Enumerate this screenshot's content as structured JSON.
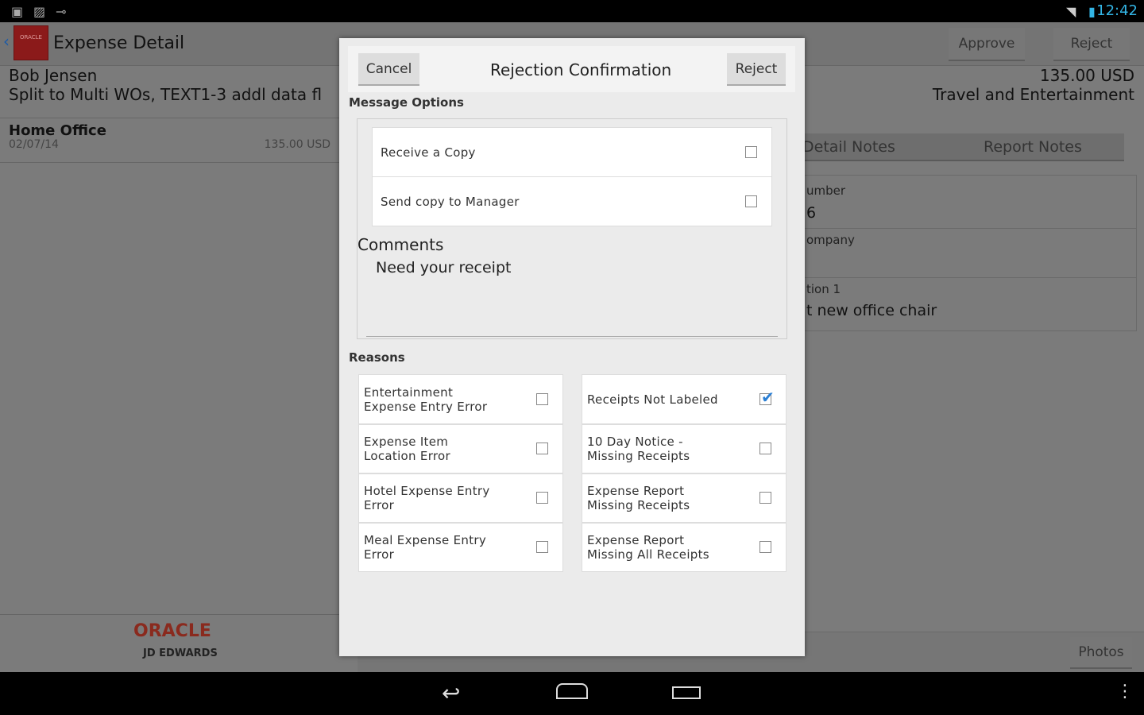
{
  "status_bar": {
    "time": "12:42",
    "icons": [
      "download-icon",
      "image-icon",
      "key-icon",
      "wifi-icon",
      "battery-charging-icon"
    ]
  },
  "header": {
    "title": "Expense Detail",
    "approve_label": "Approve",
    "reject_label": "Reject",
    "logo_text": "ORACLE JD EDWARDS ENTERPRISEONE"
  },
  "left": {
    "employee": "Bob Jensen",
    "description": "Split to Multi WOs, TEXT1-3 addl data fl",
    "item_title": "Home Office",
    "item_date": "02/07/14",
    "item_amount": "135.00 USD",
    "footer_logo": "ORACLE",
    "footer_sub": "JD EDWARDS"
  },
  "right": {
    "amount": "135.00 USD",
    "category": "Travel and Entertainment",
    "tabs": [
      "Detail Notes",
      "Report Notes"
    ],
    "fields": [
      {
        "label": "umber",
        "value": "6"
      },
      {
        "label": "ompany",
        "value": ""
      },
      {
        "label": "tion 1",
        "value": "t new office chair"
      }
    ],
    "photos_label": "Photos"
  },
  "dialog": {
    "title": "Rejection Confirmation",
    "cancel_label": "Cancel",
    "reject_label": "Reject",
    "message_options_heading": "Message Options",
    "message_options": [
      {
        "label": "Receive a Copy",
        "checked": false
      },
      {
        "label": "Send copy to Manager",
        "checked": false
      }
    ],
    "comments_label": "Comments",
    "comments_value": "Need your receipt",
    "reasons_heading": "Reasons",
    "reasons_left": [
      {
        "line1": "Entertainment",
        "line2": "Expense Entry Error",
        "checked": false
      },
      {
        "line1": "Expense Item",
        "line2": "Location Error",
        "checked": false
      },
      {
        "line1": "Hotel Expense Entry",
        "line2": "Error",
        "checked": false
      },
      {
        "line1": "Meal Expense Entry",
        "line2": "Error",
        "checked": false
      }
    ],
    "reasons_right": [
      {
        "line1": "Receipts Not Labeled",
        "line2": "",
        "checked": true
      },
      {
        "line1": "10 Day Notice -",
        "line2": "Missing Receipts",
        "checked": false
      },
      {
        "line1": "Expense Report",
        "line2": "Missing Receipts",
        "checked": false
      },
      {
        "line1": "Expense Report",
        "line2": "Missing All Receipts",
        "checked": false
      }
    ]
  },
  "colors": {
    "accent": "#33b5e5",
    "check": "#2a7fd4",
    "oracle_red": "#c0392b"
  }
}
